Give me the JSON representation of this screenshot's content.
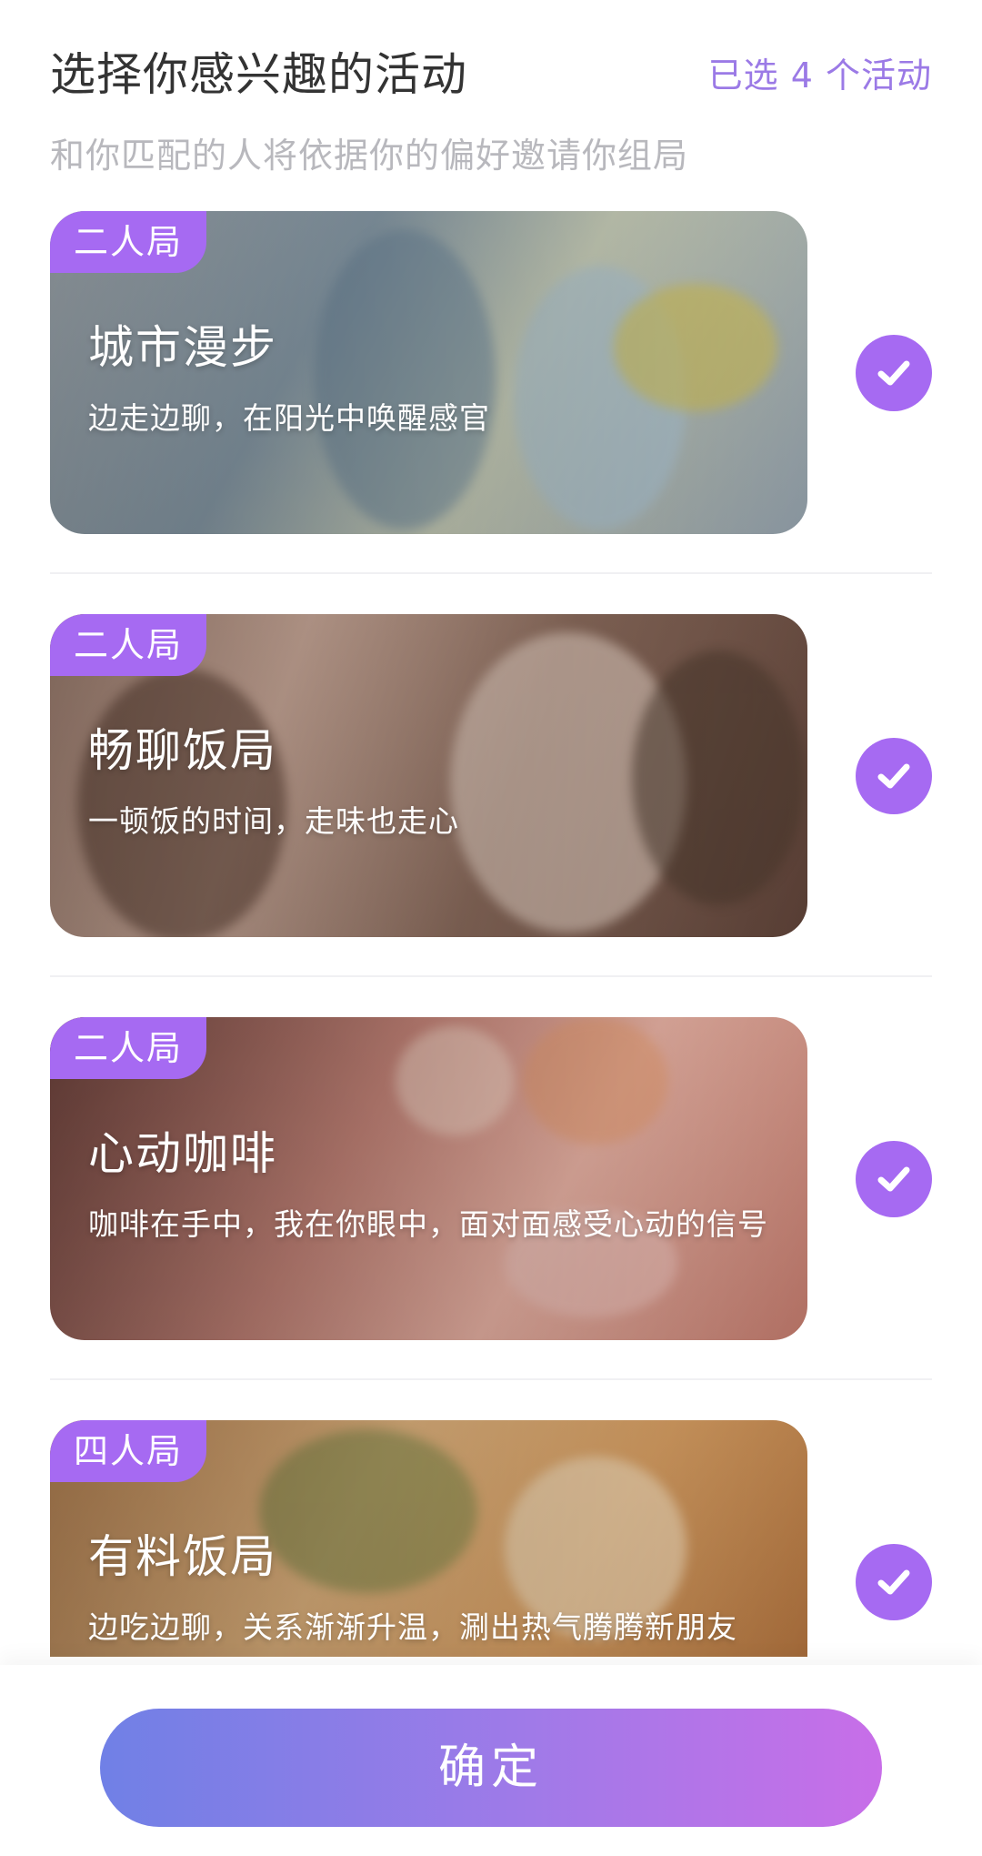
{
  "header": {
    "title": "选择你感兴趣的活动",
    "selected_count": "已选 4 个活动",
    "subtitle": "和你匹配的人将依据你的偏好邀请你组局"
  },
  "activities": [
    {
      "tag": "二人局",
      "title": "城市漫步",
      "desc": "边走边聊，在阳光中唤醒感官",
      "selected": true
    },
    {
      "tag": "二人局",
      "title": "畅聊饭局",
      "desc": "一顿饭的时间，走味也走心",
      "selected": true
    },
    {
      "tag": "二人局",
      "title": "心动咖啡",
      "desc": "咖啡在手中，我在你眼中，面对面感受心动的信号",
      "selected": true
    },
    {
      "tag": "四人局",
      "title": "有料饭局",
      "desc": "边吃边聊，关系渐渐升温，涮出热气腾腾新朋友",
      "selected": true
    }
  ],
  "footer": {
    "confirm_label": "确定"
  },
  "colors": {
    "accent": "#a66af2",
    "count_text": "#9b7ae6",
    "button_gradient_start": "#7080e6",
    "button_gradient_end": "#c86ee8"
  }
}
